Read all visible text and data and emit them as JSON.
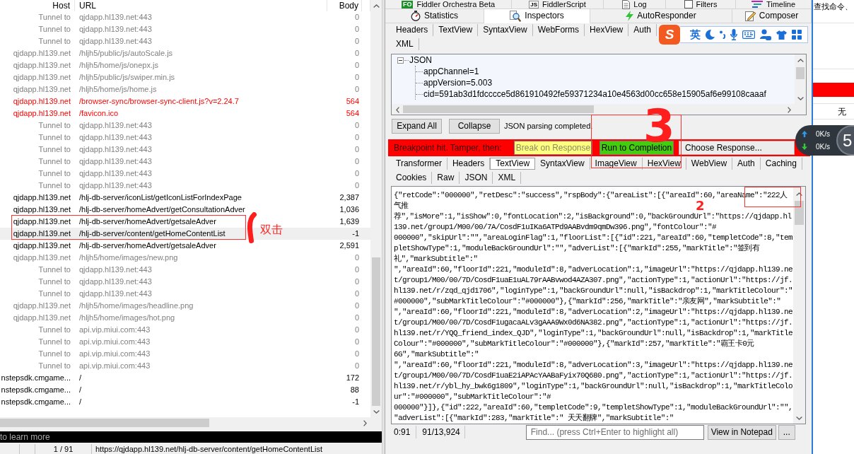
{
  "main_tabs": [
    [
      {
        "label": "Fiddler Orchestra Beta",
        "badge": "FO",
        "selected": false
      },
      {
        "label": "FiddlerScript",
        "badge": "JS",
        "selected": false
      },
      {
        "label": "Log",
        "selected": false
      },
      {
        "label": "Filters",
        "selected": false
      },
      {
        "label": "Timeline",
        "selected": false
      }
    ],
    [
      {
        "label": "Statistics",
        "selected": false
      },
      {
        "label": "Inspectors",
        "selected": true
      },
      {
        "label": "AutoResponder",
        "selected": false
      },
      {
        "label": "Composer",
        "selected": false
      }
    ]
  ],
  "sessions": {
    "columns": [
      "Host",
      "URL",
      "Body"
    ],
    "rows": [
      {
        "host": "Tunnel to",
        "url": "qjdapp.hl139.net:443",
        "body": "0",
        "color": "#808080",
        "selected": false
      },
      {
        "host": "Tunnel to",
        "url": "qjdapp.hl139.net:443",
        "body": "0",
        "color": "#808080",
        "selected": false
      },
      {
        "host": "Tunnel to",
        "url": "qjdapp.hl139.net:443",
        "body": "0",
        "color": "#808080",
        "selected": false
      },
      {
        "host": "qjdapp.hl139.net",
        "url": "/hljh5/public/js/autoScale.js",
        "body": "0",
        "color": "#808080",
        "selected": false
      },
      {
        "host": "qjdapp.hl139.net",
        "url": "/hljh5/home/js/onepx.js",
        "body": "0",
        "color": "#808080",
        "selected": false
      },
      {
        "host": "qjdapp.hl139.net",
        "url": "/hljh5/public/js/swiper.min.js",
        "body": "0",
        "color": "#808080",
        "selected": false
      },
      {
        "host": "qjdapp.hl139.net",
        "url": "/hljh5/home/js/home.js",
        "body": "0",
        "color": "#808080",
        "selected": false
      },
      {
        "host": "qjdapp.hl139.net",
        "url": "/browser-sync/browser-sync-client.js?v=2.24.7",
        "body": "564",
        "color": "#ff0000",
        "selected": false
      },
      {
        "host": "qjdapp.hl139.net",
        "url": "/favicon.ico",
        "body": "564",
        "color": "#ff0000",
        "selected": false
      },
      {
        "host": "Tunnel to",
        "url": "qjdapp.hl139.net:443",
        "body": "0",
        "color": "#808080",
        "selected": false
      },
      {
        "host": "Tunnel to",
        "url": "qjdapp.hl139.net:443",
        "body": "0",
        "color": "#808080",
        "selected": false
      },
      {
        "host": "Tunnel to",
        "url": "qjdapp.hl139.net:443",
        "body": "0",
        "color": "#808080",
        "selected": false
      },
      {
        "host": "Tunnel to",
        "url": "qjdapp.hl139.net:443",
        "body": "0",
        "color": "#808080",
        "selected": false
      },
      {
        "host": "Tunnel to",
        "url": "qjdapp.hl139.net:443",
        "body": "0",
        "color": "#808080",
        "selected": false
      },
      {
        "host": "Tunnel to",
        "url": "qjdapp.hl139.net:443",
        "body": "0",
        "color": "#808080",
        "selected": false
      },
      {
        "host": "qjdapp.hl139.net",
        "url": "/hlj-db-server/iconList/getIconListForIndexPage",
        "body": "2,387",
        "color": "#000000",
        "selected": false
      },
      {
        "host": "qjdapp.hl139.net",
        "url": "/hlj-db-server/homeAdvert/getConsultationAdver",
        "body": "1,036",
        "color": "#000000",
        "selected": false
      },
      {
        "host": "qjdapp.hl139.net",
        "url": "/hlj-db-server/homeAdvert/getsaleAdver",
        "body": "1,639",
        "color": "#000000",
        "selected": false
      },
      {
        "host": "qjdapp.hl139.net",
        "url": "/hlj-db-server/content/getHomeContentList",
        "body": "-1",
        "color": "#000000",
        "selected": true
      },
      {
        "host": "qjdapp.hl139.net",
        "url": "/hlj-db-server/homeAdvert/getsaleAdver",
        "body": "2,591",
        "color": "#000000",
        "selected": false
      },
      {
        "host": "qjdapp.hl139.net",
        "url": "/hljh5/home/images/new.png",
        "body": "0",
        "color": "#808080",
        "selected": false
      },
      {
        "host": "Tunnel to",
        "url": "qjdapp.hl139.net:443",
        "body": "0",
        "color": "#808080",
        "selected": false
      },
      {
        "host": "Tunnel to",
        "url": "qjdapp.hl139.net:443",
        "body": "0",
        "color": "#808080",
        "selected": false
      },
      {
        "host": "Tunnel to",
        "url": "qjdapp.hl139.net:443",
        "body": "0",
        "color": "#808080",
        "selected": false
      },
      {
        "host": "qjdapp.hl139.net",
        "url": "/hljh5/home/images/headline.png",
        "body": "0",
        "color": "#808080",
        "selected": false
      },
      {
        "host": "qjdapp.hl139.net",
        "url": "/hljh5/home/images/hot.png",
        "body": "0",
        "color": "#808080",
        "selected": false
      },
      {
        "host": "Tunnel to",
        "url": "api.vip.miui.com:443",
        "body": "0",
        "color": "#808080",
        "selected": false
      },
      {
        "host": "Tunnel to",
        "url": "api.vip.miui.com:443",
        "body": "0",
        "color": "#808080",
        "selected": false
      },
      {
        "host": "Tunnel to",
        "url": "api.vip.miui.com:443",
        "body": "0",
        "color": "#808080",
        "selected": false
      },
      {
        "host": "Tunnel to",
        "url": "api.vip.miui.com:443",
        "body": "0",
        "color": "#808080",
        "selected": false
      },
      {
        "host": "nstepsdk.cmgame...",
        "url": "/",
        "body": "172",
        "color": "#000000",
        "selected": false
      },
      {
        "host": "nstepsdk.cmgame...",
        "url": "/",
        "body": "88",
        "color": "#000000",
        "selected": false
      },
      {
        "host": "nstepsdk.cmgame...",
        "url": "/",
        "body": "-1",
        "color": "#000000",
        "selected": false
      }
    ]
  },
  "quickexec": "to learn more",
  "status_bar": {
    "count": "1 / 91",
    "url": "https://qjdapp.hl139.net/hlj-db-server/content/getHomeContentList"
  },
  "request": {
    "tabs": [
      [
        {
          "label": "Headers",
          "selected": false
        },
        {
          "label": "TextView",
          "selected": false
        },
        {
          "label": "SyntaxView",
          "selected": false
        },
        {
          "label": "WebForms",
          "selected": false
        },
        {
          "label": "HexView",
          "selected": false
        },
        {
          "label": "Auth",
          "selected": false
        }
      ],
      [
        {
          "label": "XML",
          "selected": false
        }
      ]
    ],
    "tree": {
      "label": "JSON",
      "expanded": true,
      "children": [
        {
          "label": "appChannel=1"
        },
        {
          "label": "appVersion=5.003"
        },
        {
          "label": "cid=591ab3d1fdcccce5d861910492fe59371234a10e4563d00cc658e15905af6e99108caaaf"
        }
      ]
    },
    "buttons": [
      "Expand All",
      "Collapse"
    ],
    "status": "JSON parsing completed."
  },
  "breakpoint": {
    "message": "Breakpoint hit. Tamper, then:",
    "buttons": [
      {
        "label": "Break on Response",
        "color": "#ffff80",
        "disabled": true
      },
      {
        "label": "Run to Completion",
        "color": "#44cc11",
        "disabled": false
      }
    ],
    "choose": "Choose Response..."
  },
  "response": {
    "tabs": [
      [
        {
          "label": "Transformer",
          "selected": false
        },
        {
          "label": "Headers",
          "selected": false
        },
        {
          "label": "TextView",
          "selected": true
        },
        {
          "label": "SyntaxView",
          "selected": false
        },
        {
          "label": "ImageView",
          "selected": false
        },
        {
          "label": "HexView",
          "selected": false
        },
        {
          "label": "WebView",
          "selected": false
        },
        {
          "label": "Auth",
          "selected": false
        },
        {
          "label": "Caching",
          "selected": false
        }
      ],
      [
        {
          "label": "Cookies",
          "selected": false
        },
        {
          "label": "Raw",
          "selected": false
        },
        {
          "label": "JSON",
          "selected": false
        },
        {
          "label": "XML",
          "selected": false
        }
      ]
    ],
    "lines": [
      "{\"retCode\":\"000000\",\"retDesc\":\"success\",\"rspBody\":{\"areaList\":[{\"areaId\":60,\"areaName\":\"222人",
      "气推",
      "荐\",\"isMore\":1,\"isShow\":0,\"fontLocation\":2,\"isBackground\":0,\"backGroundUrl\":\"https://qjdapp.hl",
      "139.net/group1/M00/00/7A/CosdF1uIKa6ATPd9AABvdm9qmDw396.png\",\"fontColour\":\"#",
      "000000\",\"skipUrl\":\"\",\"areaLoginFlag\":1,\"floorList\":[{\"id\":221,\"areaId\":60,\"templetCode\":8,\"tem",
      "pletShowType\":1,\"moduleBackGroundUrl\":\"\",\"adverList\":[{\"markId\":255,\"markTitle\":\"签到有",
      "礼\",\"markSubtitle\":\"",
      "\",\"areaId\":60,\"floorId\":221,\"moduleId\":8,\"adverLocation\":1,\"imageUrl\":\"https://qjdapp.hl139.ne",
      "t/group1/M00/00/7D/CosdF1uaE1uAL79rAABvwod4AZA307.png\",\"actionType\":1,\"actionUrl\":\"https://jf.",
      "hl139.net/r/zqd_qjd1706\",\"loginType\":1,\"backGroundUrl\":null,\"isBackdrop\":1,\"markTitleColour\":\"",
      "#000000\",\"subMarkTitleColour\":\"#000000\"},{\"markId\":256,\"markTitle\":\"亲友网\",\"markSubtitle\":\"",
      "\",\"areaId\":60,\"floorId\":221,\"moduleId\":8,\"adverLocation\":2,\"imageUrl\":\"https://qjdapp.hl139.ne",
      "t/group1/M00/00/7D/CosdF1ugacaALv3gAAA9Wx0d6NA382.png\",\"actionType\":1,\"actionUrl\":\"https://jf.",
      "hl139.net/r/YQQ_friend_index_QJD\",\"loginType\":1,\"backGroundUrl\":null,\"isBackdrop\":1,\"markTitle",
      "Colour\":\"#000000\",\"subMarkTitleColour\":\"#000000\"},{\"markId\":257,\"markTitle\":\"霸王卡0元",
      "6G\",\"markSubtitle\":\"",
      "\",\"areaId\":60,\"floorId\":221,\"moduleId\":8,\"adverLocation\":3,\"imageUrl\":\"https://qjdapp.hl139.ne",
      "t/group1/M00/00/7D/CosdF1uaE2iAPAcYAABaFyix70Q680.png\",\"actionType\":1,\"actionUrl\":\"https://jf.",
      "hl139.net/r/ybl_hy_bwk6g1809\",\"loginType\":1,\"backGroundUrl\":null,\"isBackdrop\":1,\"markTitleColo",
      "ur\":\"#000000\",\"subMarkTitleColour\":\"#",
      "000000\"}]},{\"id\":222,\"areaId\":60,\"templetCode\":9,\"templetShowType\":1,\"moduleBackGroundUrl\":\"\",",
      "\"adverList\":[{\"markId\":283,\"markTitle\":\" 天天翻牌\",\"markSubtitle\":\""
    ],
    "caret": "0:91",
    "selection": "91/13,924",
    "find": {
      "placeholder": "Find... (press Ctrl+Enter to highlight all)"
    },
    "buttons": [
      "View in Notepad",
      "..."
    ]
  },
  "ime_toolbar": {
    "logo": "S",
    "mode": "英"
  },
  "side_window": {
    "search": "查找命令、",
    "value": "无"
  },
  "net_speed": {
    "upload": "0K/s",
    "download": "0K/s",
    "count": "5"
  },
  "annotations": [
    {
      "kind": "note",
      "text": "双击"
    },
    {
      "kind": "digit",
      "text": "3"
    },
    {
      "kind": "digit",
      "text": "2"
    }
  ]
}
